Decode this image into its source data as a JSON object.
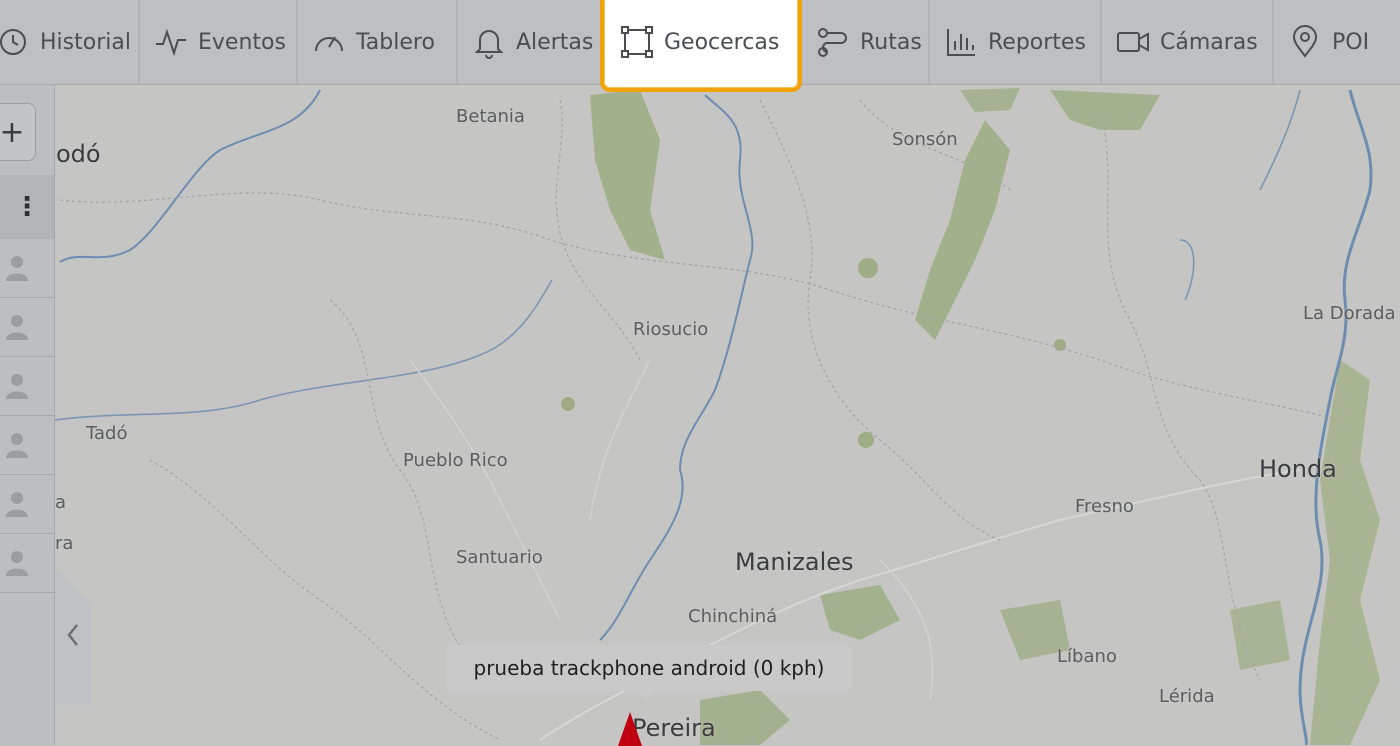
{
  "topbar": {
    "tabs": [
      {
        "label": "Historial",
        "icon": "history-icon"
      },
      {
        "label": "Eventos",
        "icon": "pulse-icon"
      },
      {
        "label": "Tablero",
        "icon": "gauge-icon"
      },
      {
        "label": "Alertas",
        "icon": "bell-icon"
      },
      {
        "label": "Geocercas",
        "icon": "geofence-icon",
        "active": true
      },
      {
        "label": "Rutas",
        "icon": "route-icon"
      },
      {
        "label": "Reportes",
        "icon": "bar-chart-icon"
      },
      {
        "label": "Cámaras",
        "icon": "camera-icon"
      },
      {
        "label": "POI",
        "icon": "map-pin-icon"
      }
    ],
    "active_color": "#f0a30a"
  },
  "sidebar": {
    "add_label": "+",
    "menu_label": "⋮",
    "user_count": 6
  },
  "map": {
    "labels": [
      {
        "text": "Betania"
      },
      {
        "text": "odó"
      },
      {
        "text": "Sonsón"
      },
      {
        "text": "Riosucio"
      },
      {
        "text": "La Dorada"
      },
      {
        "text": "Tadó"
      },
      {
        "text": "Pueblo Rico"
      },
      {
        "text": "Honda"
      },
      {
        "text": "Fresno"
      },
      {
        "text": "Santuario"
      },
      {
        "text": "Manizales"
      },
      {
        "text": "Chinchiná"
      },
      {
        "text": "Líbano"
      },
      {
        "text": "Lérida"
      },
      {
        "text": "Pereira"
      },
      {
        "text": "a"
      },
      {
        "text": "ra"
      }
    ],
    "tooltip": "prueba trackphone android (0 kph)",
    "marker_color": "#c00010"
  }
}
